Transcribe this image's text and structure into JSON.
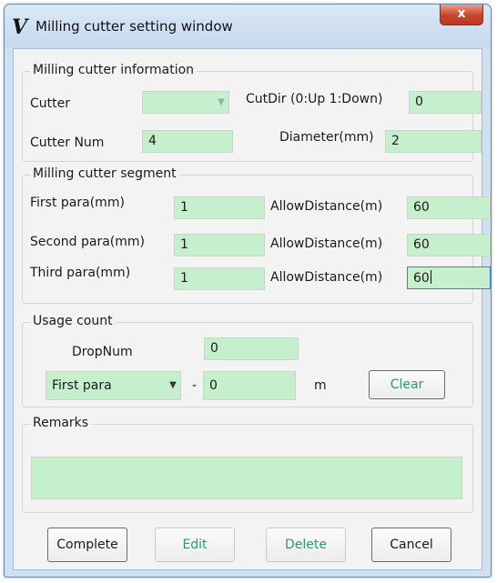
{
  "window": {
    "title": "Milling cutter setting window",
    "close_glyph": "x",
    "app_icon_glyph": "V"
  },
  "info": {
    "legend": "Milling cutter information",
    "cutter_label": "Cutter",
    "cutter_value": "",
    "cutdir_label": "CutDir (0:Up 1:Down)",
    "cutdir_value": "0",
    "cutter_num_label": "Cutter Num",
    "cutter_num_value": "4",
    "diameter_label": "Diameter(mm)",
    "diameter_value": "2"
  },
  "segment": {
    "legend": "Milling cutter segment",
    "rows": [
      {
        "para_label": "First para(mm)",
        "para_value": "1",
        "allow_label": "AllowDistance(m)",
        "allow_value": "60"
      },
      {
        "para_label": "Second para(mm)",
        "para_value": "1",
        "allow_label": "AllowDistance(m)",
        "allow_value": "60"
      },
      {
        "para_label": "Third para(mm)",
        "para_value": "1",
        "allow_label": "AllowDistance(m)",
        "allow_value": "60"
      }
    ]
  },
  "usage": {
    "legend": "Usage count",
    "dropnum_label": "DropNum",
    "dropnum_value": "0",
    "para_select_value": "First para",
    "dash": "-",
    "distance_value": "0",
    "unit": "m",
    "clear_label": "Clear"
  },
  "remarks": {
    "legend": "Remarks",
    "value": ""
  },
  "buttons": {
    "complete": "Complete",
    "edit": "Edit",
    "delete": "Delete",
    "cancel": "Cancel"
  },
  "colors": {
    "field_bg": "#c6efce",
    "window_frame": "#cfe0f1",
    "close_button": "#c8452a",
    "accent_text": "#2f9a6a"
  },
  "icons": {
    "app": "app-logo-icon",
    "close": "close-icon",
    "dropdown": "chevron-down-icon"
  }
}
